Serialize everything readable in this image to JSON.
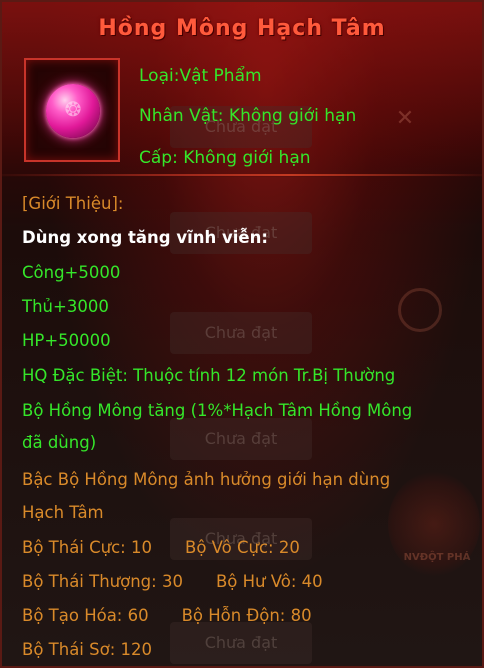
{
  "item": {
    "name": "Hồng Mông Hạch Tâm",
    "type_label": "Loại:Vật Phẩm",
    "character_label": "Nhân Vật: Không giới hạn",
    "level_label": "Cấp: Không giới hạn"
  },
  "description": {
    "intro_heading": "[Giới Thiệu]:",
    "use_note": "Dùng xong tăng vĩnh viễn:",
    "stats": [
      "Công+5000",
      "Thủ+3000",
      "HP+50000"
    ],
    "special": "HQ Đặc Biệt: Thuộc tính 12 món Tr.Bị Thường",
    "set_bonus_line1": "Bộ Hồng Mông tăng (1%*Hạch Tâm Hồng Mông",
    "set_bonus_line2": "đã dùng)",
    "limit_line1": "Bậc Bộ Hồng Mông ảnh hưởng giới hạn dùng",
    "limit_line2": "Hạch Tâm",
    "limits": [
      [
        "Bộ Thái Cực: 10",
        "Bộ Vô Cực: 20"
      ],
      [
        "Bộ Thái Thượng: 30",
        "Bộ Hư Vô: 40"
      ],
      [
        "Bộ Tạo Hóa: 60",
        "Bộ Hỗn Độn: 80"
      ],
      [
        "Bộ Thái Sơ: 120",
        ""
      ]
    ]
  },
  "background": {
    "button_label": "Chưa đạt",
    "emblem_text": "NVĐỘT PHÁ"
  },
  "colors": {
    "title": "#ff5a3c",
    "green": "#35e62a",
    "amber": "#d98a2a",
    "white": "#ffffff",
    "frame": "#c8342a"
  }
}
